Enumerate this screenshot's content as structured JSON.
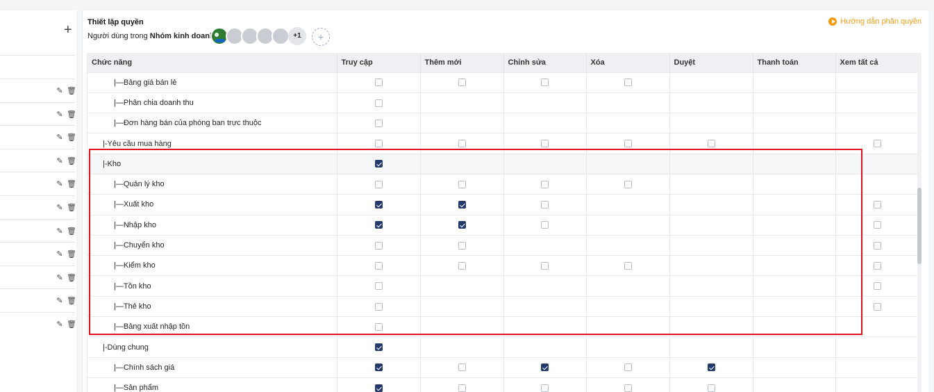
{
  "header": {
    "title": "Thiết lập quyền",
    "subtitle_prefix": "Người dùng trong ",
    "group_name": "Nhóm kinh doanh:",
    "help_link": "Hướng dẫn phân quyền",
    "avatar_more": "+1",
    "add_role_symbol": "+",
    "add_member_symbol": "+"
  },
  "columns": [
    "Chức năng",
    "Truy cập",
    "Thêm mới",
    "Chỉnh sửa",
    "Xóa",
    "Duyệt",
    "Thanh toán",
    "Xem tất cả"
  ],
  "rows": [
    {
      "label": "|—Bảng giá bán lẻ",
      "cells": [
        "off",
        "off",
        "off",
        "off",
        "",
        "",
        ""
      ]
    },
    {
      "label": "|—Phân chia doanh thu",
      "cells": [
        "off",
        "",
        "",
        "",
        "",
        "",
        ""
      ]
    },
    {
      "label": "|—Đơn hàng bán của phòng ban trực thuộc",
      "cells": [
        "off",
        "",
        "",
        "",
        "",
        "",
        ""
      ]
    },
    {
      "label": "|-Yêu cầu mua hàng",
      "cells": [
        "off",
        "off",
        "off",
        "off",
        "off",
        "",
        "off"
      ]
    },
    {
      "label": "|-Kho",
      "cells": [
        "on",
        "",
        "",
        "",
        "",
        "",
        ""
      ]
    },
    {
      "label": "|—Quản lý kho",
      "cells": [
        "off",
        "off",
        "off",
        "off",
        "",
        "",
        ""
      ]
    },
    {
      "label": "|—Xuất kho",
      "cells": [
        "on",
        "on",
        "off",
        "",
        "",
        "",
        "off"
      ]
    },
    {
      "label": "|—Nhập kho",
      "cells": [
        "on",
        "on",
        "off",
        "",
        "",
        "",
        "off"
      ]
    },
    {
      "label": "|—Chuyển kho",
      "cells": [
        "off",
        "off",
        "",
        "",
        "",
        "",
        "off"
      ]
    },
    {
      "label": "|—Kiểm kho",
      "cells": [
        "off",
        "off",
        "off",
        "off",
        "",
        "",
        "off"
      ]
    },
    {
      "label": "|—Tồn kho",
      "cells": [
        "off",
        "",
        "",
        "",
        "",
        "",
        "off"
      ]
    },
    {
      "label": "|—Thẻ kho",
      "cells": [
        "off",
        "",
        "",
        "",
        "",
        "",
        "off"
      ]
    },
    {
      "label": "|—Bảng xuất nhập tồn",
      "cells": [
        "off",
        "",
        "",
        "",
        "",
        "",
        ""
      ]
    },
    {
      "label": "|-Dùng chung",
      "cells": [
        "on",
        "",
        "",
        "",
        "",
        "",
        ""
      ]
    },
    {
      "label": "|—Chính sách giá",
      "cells": [
        "on",
        "off",
        "on",
        "off",
        "on",
        "",
        ""
      ]
    },
    {
      "label": "|—Sản phẩm",
      "cells": [
        "on",
        "off",
        "off",
        "off",
        "off",
        "",
        ""
      ]
    }
  ],
  "sidebar": {
    "role_rows": 11,
    "edit_icon": "pencil-icon",
    "delete_icon": "trash-icon"
  },
  "colors": {
    "accent": "#f39c12",
    "checkbox_checked": "#233a6b",
    "highlight_box": "#e0101c"
  }
}
